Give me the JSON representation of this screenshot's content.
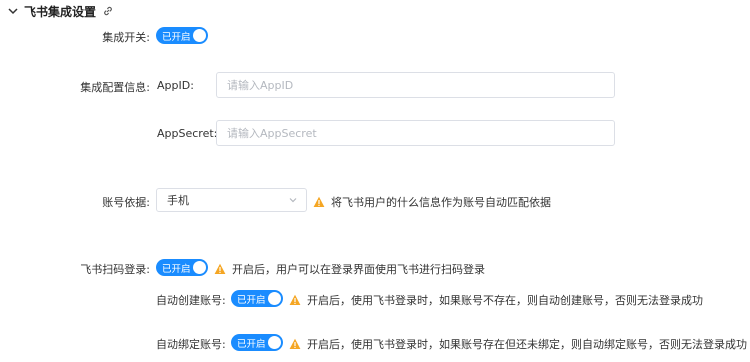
{
  "section": {
    "title": "飞书集成设置"
  },
  "integration_switch": {
    "label": "集成开关:",
    "toggle_text": "已开启"
  },
  "config": {
    "label": "集成配置信息:",
    "appid_label": "AppID:",
    "appid_placeholder": "请输入AppID",
    "appsecret_label": "AppSecret:",
    "appsecret_placeholder": "请输入AppSecret"
  },
  "account_basis": {
    "label": "账号依据:",
    "selected": "手机",
    "hint": "将飞书用户的什么信息作为账号自动匹配依据"
  },
  "qr_login": {
    "label": "飞书扫码登录:",
    "toggle_text": "已开启",
    "hint": "开启后，用户可以在登录界面使用飞书进行扫码登录"
  },
  "auto_create": {
    "label": "自动创建账号:",
    "toggle_text": "已开启",
    "hint": "开启后，使用飞书登录时，如果账号不存在，则自动创建账号，否则无法登录成功"
  },
  "auto_bind": {
    "label": "自动绑定账号:",
    "toggle_text": "已开启",
    "hint": "开启后，使用飞书登录时，如果账号存在但还未绑定，则自动绑定账号，否则无法登录成功"
  },
  "colors": {
    "accent": "#1a8cff",
    "warning": "#f5a623"
  },
  "icons": [
    "chevron-down-icon",
    "link-icon",
    "warning-icon",
    "select-arrow-icon"
  ]
}
